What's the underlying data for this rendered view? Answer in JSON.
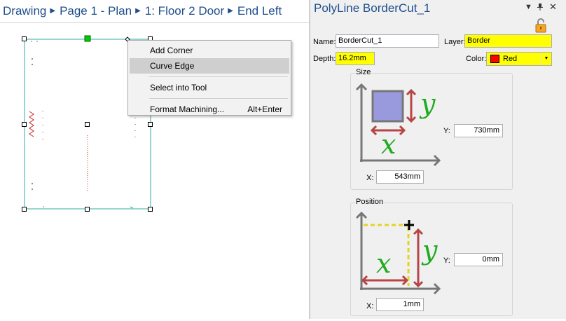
{
  "breadcrumb": [
    "Drawing",
    "Page 1 - Plan",
    "1: Floor 2 Door",
    "End Left"
  ],
  "context_menu": {
    "items": [
      {
        "label": "Add Corner",
        "shortcut": ""
      },
      {
        "label": "Curve Edge",
        "shortcut": ""
      },
      {
        "label": "Select into Tool",
        "shortcut": ""
      },
      {
        "label": "Format Machining...",
        "shortcut": "Alt+Enter"
      }
    ],
    "highlighted": "Curve Edge"
  },
  "panel": {
    "title": "PolyLine BorderCut_1",
    "name_label": "Name:",
    "name_value": "BorderCut_1",
    "layer_label": "Layer:",
    "layer_value": "Border",
    "depth_label": "Depth:",
    "depth_value": "16.2mm",
    "color_label": "Color:",
    "color_value": "Red",
    "size": {
      "title": "Size",
      "y_label": "Y:",
      "y_value": "730mm",
      "x_label": "X:",
      "x_value": "543mm"
    },
    "position": {
      "title": "Position",
      "y_label": "Y:",
      "y_value": "0mm",
      "x_label": "X:",
      "x_value": "1mm"
    }
  },
  "colors": {
    "accent_text": "#1f4e8c",
    "highlight_field": "#ffff00",
    "shape_outline": "#3aa8a0",
    "machining_marks": "#cc2222",
    "selected_handle": "#00cc00"
  },
  "icons": {
    "breadcrumb_separator": "triangle-right-icon",
    "panel_dropdown": "triangle-down-icon",
    "panel_pin": "pin-icon",
    "panel_close": "close-icon",
    "lock": "padlock-icon"
  }
}
